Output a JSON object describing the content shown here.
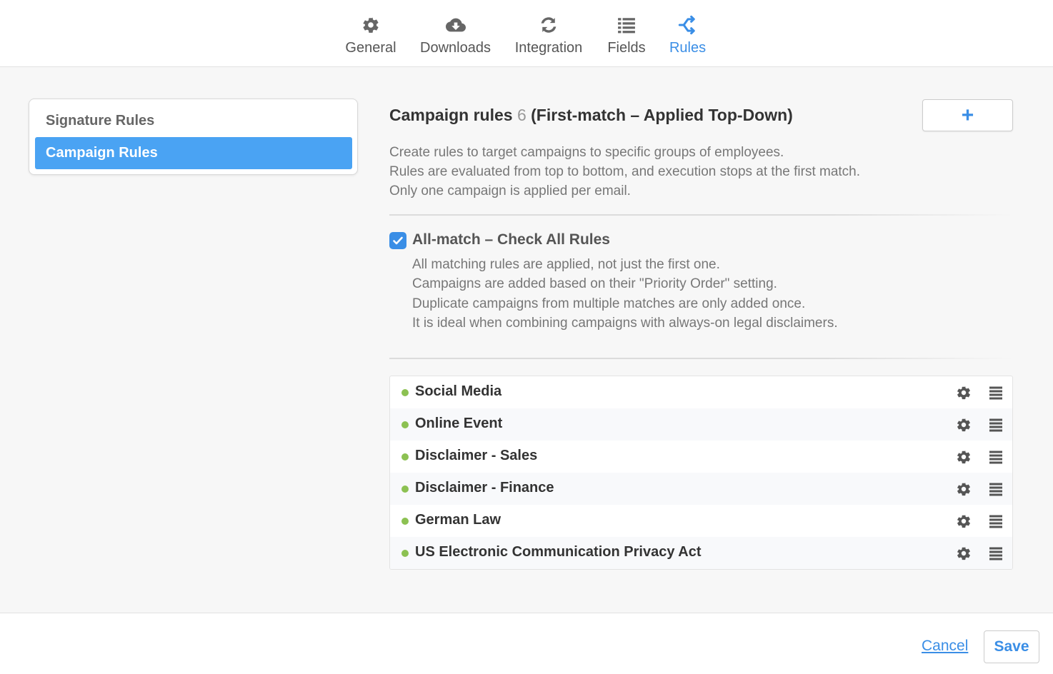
{
  "tabs": [
    {
      "label": "General",
      "icon": "gear-icon"
    },
    {
      "label": "Downloads",
      "icon": "cloud-download-icon"
    },
    {
      "label": "Integration",
      "icon": "refresh-icon"
    },
    {
      "label": "Fields",
      "icon": "list-icon"
    },
    {
      "label": "Rules",
      "icon": "branch-icon",
      "active": true
    }
  ],
  "sidebar": {
    "items": [
      {
        "label": "Signature Rules"
      },
      {
        "label": "Campaign Rules",
        "active": true
      }
    ]
  },
  "main": {
    "title_prefix": "Campaign rules",
    "count": "6",
    "title_suffix": "(First-match – Applied Top-Down)",
    "add_button_label": "+",
    "description": [
      "Create rules to target campaigns to specific groups of employees.",
      "Rules are evaluated from top to bottom, and execution stops at the first match.",
      "Only one campaign is applied per email."
    ],
    "all_match": {
      "checked": true,
      "label": "All-match – Check All Rules",
      "description": [
        "All matching rules are applied, not just the first one.",
        "Campaigns are added based on their \"Priority Order\" setting.",
        "Duplicate campaigns from multiple matches are only added once.",
        "It is ideal when combining campaigns with always-on legal disclaimers."
      ]
    },
    "rules": [
      {
        "name": "Social Media",
        "status": "active"
      },
      {
        "name": "Online Event",
        "status": "active"
      },
      {
        "name": "Disclaimer - Sales",
        "status": "active"
      },
      {
        "name": "Disclaimer - Finance",
        "status": "active"
      },
      {
        "name": "German Law",
        "status": "active"
      },
      {
        "name": "US Electronic Communication Privacy Act",
        "status": "active"
      }
    ]
  },
  "footer": {
    "cancel_label": "Cancel",
    "save_label": "Save"
  },
  "colors": {
    "accent": "#3a8ee6",
    "sidebar_active": "#4aa3f3",
    "status_active": "#8cc152"
  }
}
